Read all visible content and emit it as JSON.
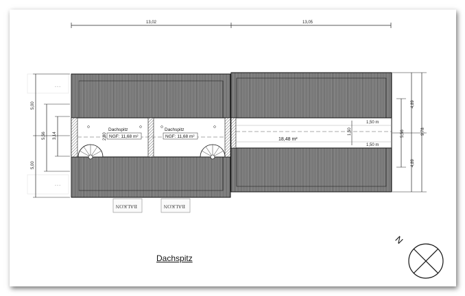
{
  "plan": {
    "title": "Dachspitz",
    "dims_top": [
      "13,02",
      "13,05"
    ],
    "dims_left": [
      "5,00",
      "5,00",
      "5,56",
      "3,14"
    ],
    "dims_right": [
      "4,89",
      "9,78",
      "4,89",
      "5,56"
    ],
    "rooms": [
      {
        "name": "Dachspitz",
        "area": "NGF: 11,68 m²",
        "height": "2,80"
      },
      {
        "name": "Dachspitz",
        "area": "NGF: 11,68 m²"
      }
    ],
    "right_area": "18,48 m²",
    "right_dims": [
      "1,50 m",
      "1,50 m",
      "1,50"
    ],
    "balcony_labels": [
      "BALKON",
      "BALKON"
    ],
    "compass_letter": "N"
  },
  "colors": {
    "roof_fill": "#8a8a8a",
    "roof_dark": "#555555",
    "line": "#111111"
  }
}
